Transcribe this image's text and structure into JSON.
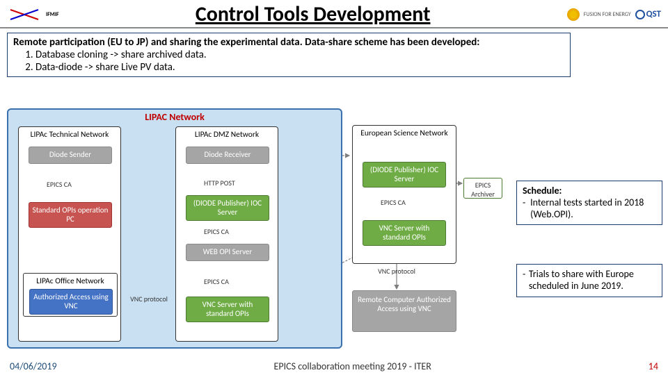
{
  "header": {
    "left_logo": "IFMIF",
    "title": "Control Tools Development",
    "right_logo1": "FUSION FOR ENERGY",
    "right_logo2": "QST"
  },
  "intro": {
    "lead": "Remote participation (EU to JP) and sharing the experimental data. Data-share scheme has been developed:",
    "items": [
      "Database cloning -> share archived data.",
      "Data-diode -> share Live PV data."
    ]
  },
  "diagram": {
    "lipac_title": "LIPAC Network",
    "col1_title": "LIPAc Technical Network",
    "col2_title": "LIPAc DMZ Network",
    "col1_nodes": {
      "diode_sender": "Diode Sender",
      "std_opi": "Standard OPIs operation PC"
    },
    "col2_nodes": {
      "diode_receiver": "Diode Receiver",
      "diode_pub": "(DIODE Publisher) IOC Server",
      "web_opi": "WEB OPI Server",
      "vnc_server": "VNC Server with standard OPIs"
    },
    "labels": {
      "epics_ca1": "EPICS CA",
      "http_post": "HTTP POST",
      "epics_ca2": "EPICS CA",
      "epics_ca3": "EPICS CA",
      "vnc_protocol1": "VNC protocol",
      "vnc_protocol2": "VNC protocol"
    },
    "office_net": "LIPAc Office Network",
    "auth_access": "Authorized Access using VNC",
    "euro_title": "European Science Network",
    "euro_nodes": {
      "diode_pub2": "(DIODE Publisher) IOC Server",
      "vnc_server2": "VNC Server with standard OPIs"
    },
    "epics_archiver": "EPICS Archiver",
    "remote": "Remote Computer Authorized Access using VNC"
  },
  "schedule": {
    "title": "Schedule:",
    "item1": "Internal tests started in 2018 (Web.OPI)."
  },
  "trials": {
    "item": "Trials to share with Europe scheduled in June 2019."
  },
  "footer": {
    "date": "04/06/2019",
    "center": "EPICS collaboration meeting 2019 - ITER",
    "page": "14"
  }
}
